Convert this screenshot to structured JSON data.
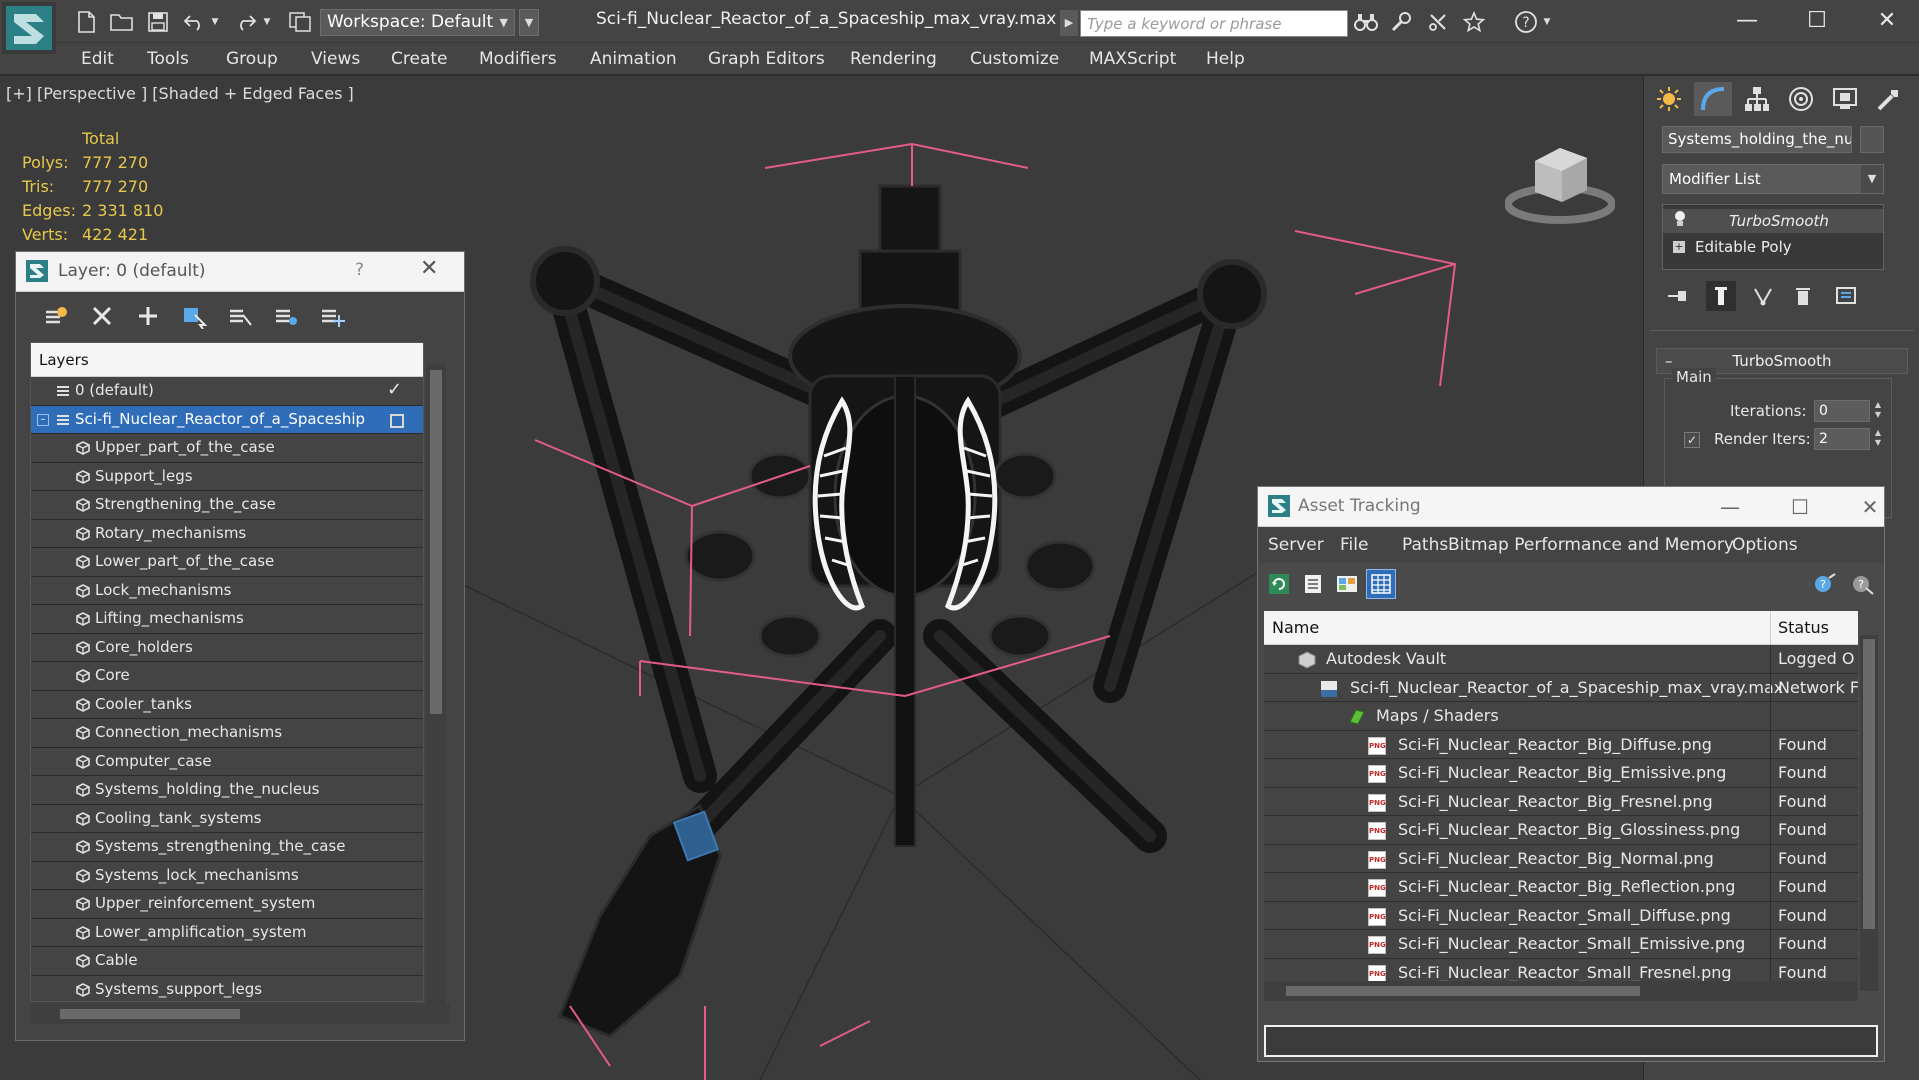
{
  "app": {
    "file_title": "Sci-fi_Nuclear_Reactor_of_a_Spaceship_max_vray.max",
    "workspace": "Workspace: Default",
    "search_placeholder": "Type a keyword or phrase",
    "accent": "#2f6db8"
  },
  "toolbar_icons": [
    "new-file-icon",
    "open-folder-icon",
    "save-icon",
    "undo-icon",
    "redo-icon",
    "project-icon"
  ],
  "search_icons": [
    "binoculars-icon",
    "search-tools-icon",
    "star-tools-icon",
    "favorite-icon",
    "help-icon"
  ],
  "window_controls": {
    "minimize": "—",
    "maximize": "☐",
    "close": "✕"
  },
  "menu": [
    "Edit",
    "Tools",
    "Group",
    "Views",
    "Create",
    "Modifiers",
    "Animation",
    "Graph Editors",
    "Rendering",
    "Customize",
    "MAXScript",
    "Help"
  ],
  "viewport": {
    "label": "[+] [Perspective ] [Shaded + Edged Faces ]",
    "stats": {
      "header": "Total",
      "rows": [
        {
          "key": "Polys:",
          "value": "777 270"
        },
        {
          "key": "Tris:",
          "value": "777 270"
        },
        {
          "key": "Edges:",
          "value": "2 331 810"
        },
        {
          "key": "Verts:",
          "value": "422 421"
        }
      ]
    }
  },
  "command_panel": {
    "tabs": [
      "create-icon",
      "modify-icon",
      "hierarchy-icon",
      "motion-icon",
      "display-icon",
      "utilities-icon"
    ],
    "object_name": "Systems_holding_the_nucleus",
    "modifier_list": "Modifier List",
    "stack": [
      {
        "label": "TurboSmooth",
        "selected": true
      },
      {
        "label": "Editable Poly",
        "selected": false
      }
    ],
    "rollout_title": "TurboSmooth",
    "group_title": "Main",
    "iterations_label": "Iterations:",
    "iterations_value": "0",
    "render_iters_label": "Render Iters:",
    "render_iters_value": "2"
  },
  "layer_window": {
    "title": "Layer: 0 (default)",
    "help": "?",
    "close": "✕",
    "header": "Layers",
    "tools": [
      "add-to-layer-icon",
      "delete-layer-icon",
      "create-layer-icon",
      "select-layer-objects-icon",
      "highlight-layer-icon",
      "hide-layers-icon",
      "freeze-layers-icon"
    ],
    "layers": [
      {
        "label": "0 (default)",
        "level": 0,
        "active": true
      },
      {
        "label": "Sci-fi_Nuclear_Reactor_of_a_Spaceship",
        "level": 0,
        "selected": true
      },
      {
        "label": "Upper_part_of_the_case",
        "level": 1
      },
      {
        "label": "Support_legs",
        "level": 1
      },
      {
        "label": "Strengthening_the_case",
        "level": 1
      },
      {
        "label": "Rotary_mechanisms",
        "level": 1
      },
      {
        "label": "Lower_part_of_the_case",
        "level": 1
      },
      {
        "label": "Lock_mechanisms",
        "level": 1
      },
      {
        "label": "Lifting_mechanisms",
        "level": 1
      },
      {
        "label": "Core_holders",
        "level": 1
      },
      {
        "label": "Core",
        "level": 1
      },
      {
        "label": "Cooler_tanks",
        "level": 1
      },
      {
        "label": "Connection_mechanisms",
        "level": 1
      },
      {
        "label": "Computer_case",
        "level": 1
      },
      {
        "label": "Systems_holding_the_nucleus",
        "level": 1
      },
      {
        "label": "Cooling_tank_systems",
        "level": 1
      },
      {
        "label": "Systems_strengthening_the_case",
        "level": 1
      },
      {
        "label": "Systems_lock_mechanisms",
        "level": 1
      },
      {
        "label": "Upper_reinforcement_system",
        "level": 1
      },
      {
        "label": "Lower_amplification_system",
        "level": 1
      },
      {
        "label": "Cable",
        "level": 1
      },
      {
        "label": "Systems_support_legs",
        "level": 1
      }
    ]
  },
  "asset_window": {
    "title": "Asset Tracking",
    "menu": [
      "Server",
      "File",
      "Paths",
      "Bitmap Performance and Memory",
      "Options"
    ],
    "tools": [
      "refresh-icon",
      "list-view-icon",
      "thumbnail-view-icon",
      "table-view-icon"
    ],
    "right_tools": [
      "vault-help-icon",
      "vault-logout-icon"
    ],
    "columns": [
      "Name",
      "Status"
    ],
    "rows": [
      {
        "name": "Autodesk Vault",
        "status": "Logged O",
        "level": 0,
        "icon": "vault-icon"
      },
      {
        "name": "Sci-fi_Nuclear_Reactor_of_a_Spaceship_max_vray.max",
        "status": "Network F",
        "level": 1,
        "icon": "max-file-icon"
      },
      {
        "name": "Maps / Shaders",
        "status": "",
        "level": 2,
        "icon": "maps-icon"
      },
      {
        "name": "Sci-Fi_Nuclear_Reactor_Big_Diffuse.png",
        "status": "Found",
        "level": 3,
        "icon": "png-icon"
      },
      {
        "name": "Sci-Fi_Nuclear_Reactor_Big_Emissive.png",
        "status": "Found",
        "level": 3,
        "icon": "png-icon"
      },
      {
        "name": "Sci-Fi_Nuclear_Reactor_Big_Fresnel.png",
        "status": "Found",
        "level": 3,
        "icon": "png-icon"
      },
      {
        "name": "Sci-Fi_Nuclear_Reactor_Big_Glossiness.png",
        "status": "Found",
        "level": 3,
        "icon": "png-icon"
      },
      {
        "name": "Sci-Fi_Nuclear_Reactor_Big_Normal.png",
        "status": "Found",
        "level": 3,
        "icon": "png-icon"
      },
      {
        "name": "Sci-Fi_Nuclear_Reactor_Big_Reflection.png",
        "status": "Found",
        "level": 3,
        "icon": "png-icon"
      },
      {
        "name": "Sci-Fi_Nuclear_Reactor_Small_Diffuse.png",
        "status": "Found",
        "level": 3,
        "icon": "png-icon"
      },
      {
        "name": "Sci-Fi_Nuclear_Reactor_Small_Emissive.png",
        "status": "Found",
        "level": 3,
        "icon": "png-icon"
      },
      {
        "name": "Sci-Fi_Nuclear_Reactor_Small_Fresnel.png",
        "status": "Found",
        "level": 3,
        "icon": "png-icon"
      }
    ]
  }
}
